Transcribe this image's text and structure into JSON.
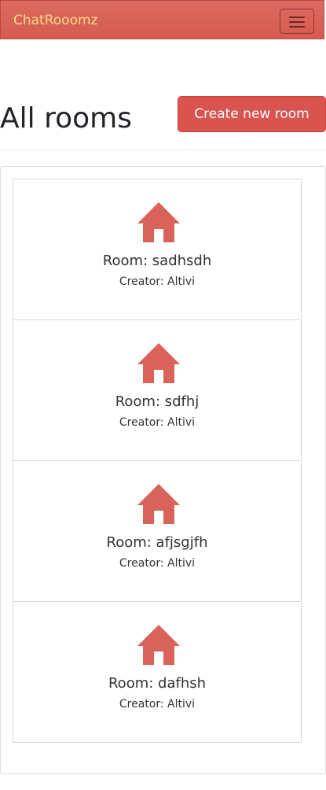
{
  "navbar": {
    "brand": "ChatRooomz",
    "toggle_icon": "hamburger-menu-icon"
  },
  "header": {
    "title": "All rooms",
    "create_button": "Create new room"
  },
  "colors": {
    "navbar": "#d65b4f",
    "brand_text": "#f8dc86",
    "accent": "#d9534f",
    "room_icon": "#d9635a"
  },
  "rooms": [
    {
      "icon": "house-icon",
      "name": "Room: sadhsdh",
      "creator": "Creator: Altivi"
    },
    {
      "icon": "house-icon",
      "name": "Room: sdfhj",
      "creator": "Creator: Altivi"
    },
    {
      "icon": "house-icon",
      "name": "Room: afjsgjfh",
      "creator": "Creator: Altivi"
    },
    {
      "icon": "house-icon",
      "name": "Room: dafhsh",
      "creator": "Creator: Altivi"
    }
  ]
}
